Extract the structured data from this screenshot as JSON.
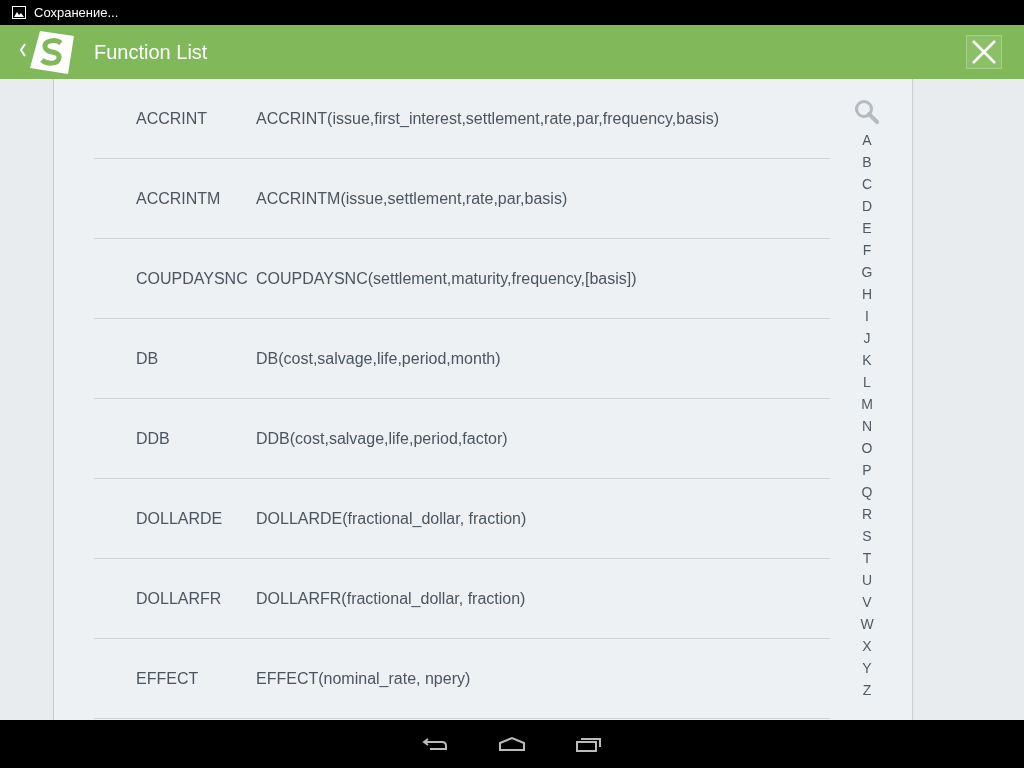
{
  "status_bar": {
    "notification": "Сохранение..."
  },
  "header": {
    "title": "Function List"
  },
  "functions": [
    {
      "name": "ACCRINT",
      "syntax": "ACCRINT(issue,first_interest,settlement,rate,par,frequency,basis)"
    },
    {
      "name": "ACCRINTM",
      "syntax": "ACCRINTM(issue,settlement,rate,par,basis)"
    },
    {
      "name": "COUPDAYSNC",
      "syntax": "COUPDAYSNC(settlement,maturity,frequency,[basis])"
    },
    {
      "name": "DB",
      "syntax": "DB(cost,salvage,life,period,month)"
    },
    {
      "name": "DDB",
      "syntax": "DDB(cost,salvage,life,period,factor)"
    },
    {
      "name": "DOLLARDE",
      "syntax": "DOLLARDE(fractional_dollar, fraction)"
    },
    {
      "name": "DOLLARFR",
      "syntax": "DOLLARFR(fractional_dollar, fraction)"
    },
    {
      "name": "EFFECT",
      "syntax": "EFFECT(nominal_rate, npery)"
    }
  ],
  "index": [
    "A",
    "B",
    "C",
    "D",
    "E",
    "F",
    "G",
    "H",
    "I",
    "J",
    "K",
    "L",
    "M",
    "N",
    "O",
    "P",
    "Q",
    "R",
    "S",
    "T",
    "U",
    "V",
    "W",
    "X",
    "Y",
    "Z"
  ]
}
